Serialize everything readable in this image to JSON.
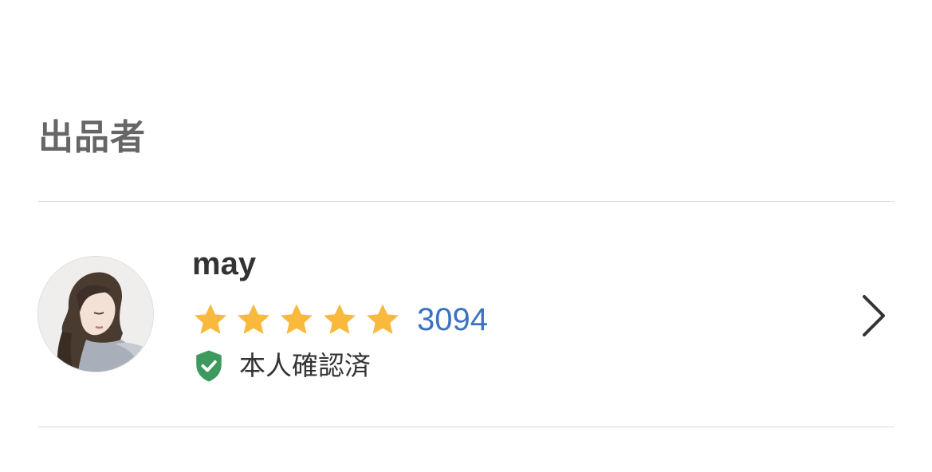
{
  "section": {
    "title": "出品者"
  },
  "seller": {
    "name": "may",
    "rating": {
      "stars": 5,
      "max_stars": 5,
      "count": "3094"
    },
    "verified_label": "本人確認済",
    "avatar_icon": "profile-photo",
    "chevron_icon": "chevron-right-icon"
  },
  "colors": {
    "star": "#f8b93c",
    "rating_count": "#3a73c2",
    "verified_shield": "#3d9a5f",
    "title": "#666666",
    "text": "#333333",
    "divider": "#d9d9d9"
  }
}
